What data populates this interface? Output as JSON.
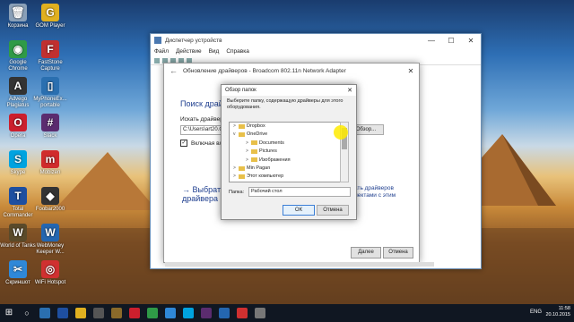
{
  "desktop": {
    "icons": [
      {
        "label": "Корзина",
        "color": "#8aa0b8",
        "glyph": "🗑"
      },
      {
        "label": "GOM Player",
        "color": "#e0b020",
        "glyph": "G"
      },
      {
        "label": "Google Chrome",
        "color": "#2f9a47",
        "glyph": "◉"
      },
      {
        "label": "FastStone Capture",
        "color": "#c03030",
        "glyph": "F"
      },
      {
        "label": "Advego Plagiatus",
        "color": "#333333",
        "glyph": "A"
      },
      {
        "label": "MyPhoneEx... portable",
        "color": "#2a6fb0",
        "glyph": "▯"
      },
      {
        "label": "Opera",
        "color": "#cc1f2d",
        "glyph": "O"
      },
      {
        "label": "Slack",
        "color": "#5b2c6f",
        "glyph": "#"
      },
      {
        "label": "Skype",
        "color": "#00a3e0",
        "glyph": "S"
      },
      {
        "label": "Mobizen",
        "color": "#d02c2c",
        "glyph": "m"
      },
      {
        "label": "Total Commander",
        "color": "#1e4fa0",
        "glyph": "T"
      },
      {
        "label": "Foobar2000",
        "color": "#333333",
        "glyph": "◆"
      },
      {
        "label": "World of Tanks",
        "color": "#5a4a2a",
        "glyph": "W"
      },
      {
        "label": "WebMoney Keeper W...",
        "color": "#2466b0",
        "glyph": "W"
      },
      {
        "label": "Скриншот",
        "color": "#2f88d8",
        "glyph": "✂"
      },
      {
        "label": "WiFi Hotspot",
        "color": "#d03030",
        "glyph": "◎"
      }
    ]
  },
  "device_manager": {
    "title": "Диспетчер устройств",
    "menu": [
      "Файл",
      "Действие",
      "Вид",
      "Справка"
    ],
    "controls": [
      "—",
      "☐",
      "✕"
    ]
  },
  "update_driver": {
    "title": "Обновление драйверов - Broadcom 802.11n Network Adapter",
    "heading": "Поиск драйверо",
    "search_label": "Искать драйверы в",
    "path_value": "C:\\Users\\art20.Or",
    "browse_label": "Обзор...",
    "include_subfolders": "Включая влож",
    "link_left": "→ Выбрать\nдрайвера",
    "link_right": "ать драйверов\nлектами с этим",
    "next_label": "Далее",
    "cancel_label": "Отмена"
  },
  "browse_folder": {
    "title": "Обзор папок",
    "description": "Выберите папку, содержащую драйверы для этого оборудования.",
    "tree": [
      {
        "label": "Dropbox",
        "indent": 0,
        "arrow": ">"
      },
      {
        "label": "OneDrive",
        "indent": 0,
        "arrow": "v"
      },
      {
        "label": "Documents",
        "indent": 1,
        "arrow": ">"
      },
      {
        "label": "Pictures",
        "indent": 1,
        "arrow": ">"
      },
      {
        "label": "Изображения",
        "indent": 1,
        "arrow": ">"
      },
      {
        "label": "Min Pagan",
        "indent": 0,
        "arrow": ">"
      },
      {
        "label": "Этот компьютер",
        "indent": 0,
        "arrow": ">"
      }
    ],
    "folder_label": "Папка:",
    "folder_value": "Рабочий стол",
    "ok_label": "ОК",
    "cancel_label": "Отмена"
  },
  "taskbar": {
    "apps": [
      "#2a6fb0",
      "#1e4fa0",
      "#e0b020",
      "#555555",
      "#8a6a2a",
      "#cc1f2d",
      "#2f9a47",
      "#2f88d8",
      "#00a3e0",
      "#5b2c6f",
      "#2466b0",
      "#d03030",
      "#777777"
    ],
    "language": "ENG",
    "time": "11:58",
    "date": "20.10.2015"
  }
}
